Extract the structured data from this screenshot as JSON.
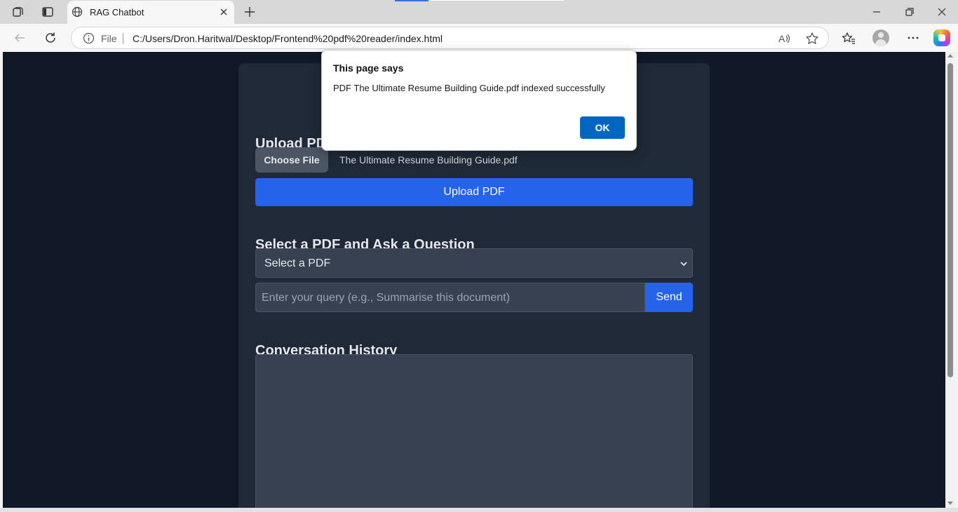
{
  "browser": {
    "tab_title": "RAG Chatbot",
    "address_label": "File",
    "url": "C:/Users/Dron.Haritwal/Desktop/Frontend%20pdf%20reader/index.html",
    "accent_color": "#0067c0"
  },
  "page": {
    "upload_heading": "Upload PDF",
    "choose_file_label": "Choose File",
    "selected_file_name": "The Ultimate Resume Building Guide.pdf",
    "upload_button_label": "Upload PDF",
    "select_heading": "Select a PDF and Ask a Question",
    "select_value": "Select a PDF",
    "query_placeholder": "Enter your query (e.g., Summarise this document)",
    "send_button_label": "Send",
    "history_heading": "Conversation History",
    "colors": {
      "background": "#111827",
      "card": "#1f2937",
      "primary": "#2563eb",
      "field": "#374151"
    }
  },
  "dialog": {
    "title": "This page says",
    "message": "PDF The Ultimate Resume Building Guide.pdf indexed successfully",
    "ok_label": "OK"
  },
  "icons": [
    "workspaces-icon",
    "vertical-tabs-icon",
    "globe-icon",
    "close-tab-icon",
    "new-tab-icon",
    "minimize-icon",
    "restore-icon",
    "close-window-icon",
    "back-icon",
    "refresh-icon",
    "info-icon",
    "read-aloud-icon",
    "favorite-star-icon",
    "favorites-icon",
    "profile-avatar",
    "more-icon",
    "copilot-icon",
    "chevron-down-icon"
  ]
}
